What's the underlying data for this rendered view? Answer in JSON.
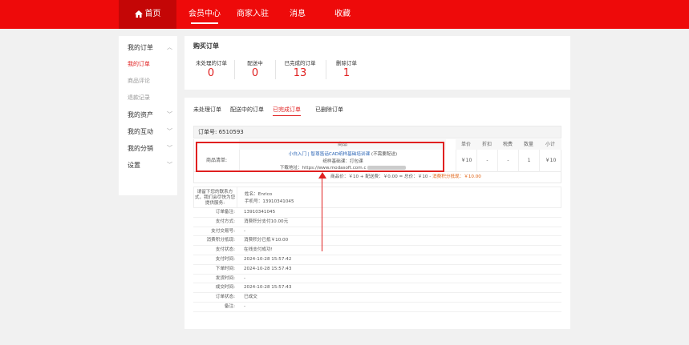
{
  "nav": {
    "home": "首页",
    "member": "会员中心",
    "merchant": "商家入驻",
    "messages": "消息",
    "favorites": "收藏"
  },
  "sidebar": {
    "groups": [
      {
        "label": "我的订单",
        "chevron": "︿"
      },
      {
        "label": "我的资产",
        "chevron": "﹀"
      },
      {
        "label": "我的互动",
        "chevron": "﹀"
      },
      {
        "label": "我的分销",
        "chevron": "﹀"
      },
      {
        "label": "设置",
        "chevron": "﹀"
      }
    ],
    "order_items": [
      {
        "label": "我的订单",
        "active": true
      },
      {
        "label": "商品评论",
        "active": false
      },
      {
        "label": "退款记录",
        "active": false
      }
    ]
  },
  "stats": {
    "title": "购买订单",
    "items": [
      {
        "label": "未处理的订单",
        "value": "0"
      },
      {
        "label": "配送中",
        "value": "0"
      },
      {
        "label": "已完成的订单",
        "value": "13"
      },
      {
        "label": "删除订单",
        "value": "1"
      }
    ]
  },
  "tabs": [
    "未处理订单",
    "配送中的订单",
    "已完成订单",
    "已删除订单"
  ],
  "active_tab": "已完成订单",
  "order": {
    "number_label": "订单号: 6510593",
    "headers": {
      "goods": "商品",
      "price": "单价",
      "discount": "折扣",
      "tax": "税费",
      "qty": "数量",
      "subtotal": "小计"
    },
    "goods_label": "商品清单:",
    "item": {
      "name": "小白入门 | 智尊笛话CAD纸样基础培训课",
      "name_note": "(不需要配送)",
      "sub": "纸样基础课：打包课",
      "download": "下载地址：https://www.modasoft.com.c",
      "price": "￥10",
      "discount": "-",
      "tax": "-",
      "qty": "1",
      "subtotal": "￥10"
    },
    "totals": "商品价：￥10 + 配送费：￥0.00 = 总价：￥10 - ",
    "totals_highlight": "消费积分抵现：￥10.00",
    "contact": {
      "label": "请留下您的联系方式，我们会尽快为您提供服务:",
      "name": "姓名：Enrico",
      "phone": "手机号：13910341045"
    },
    "details": [
      {
        "key": "订单备注:",
        "value": "13910341045"
      },
      {
        "key": "支付方式:",
        "value": "消费积分支付10.00元"
      },
      {
        "key": "支付交易号:",
        "value": "-"
      },
      {
        "key": "消费积分抵现:",
        "value": "消费积分已抵￥10.00"
      },
      {
        "key": "支付状态:",
        "value": "在线支付成功!"
      },
      {
        "key": "支付时间:",
        "value": "2024-10-28 15:57:42"
      },
      {
        "key": "下单时间:",
        "value": "2024-10-28 15:57:43"
      },
      {
        "key": "发货时间:",
        "value": "-"
      },
      {
        "key": "成交时间:",
        "value": "2024-10-28 15:57:43"
      },
      {
        "key": "订单状态:",
        "value": "已成交"
      },
      {
        "key": "备注:",
        "value": "-"
      }
    ]
  },
  "colors": {
    "brand": "#ee0a0a",
    "accent": "#e02020"
  }
}
